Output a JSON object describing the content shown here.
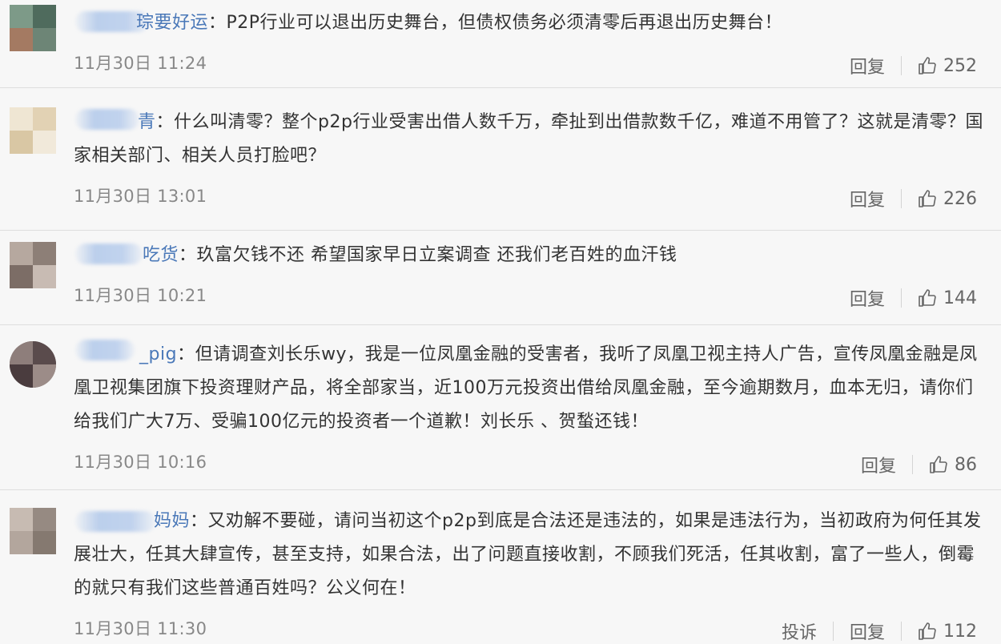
{
  "icons": {
    "like": "thumbs-up-icon"
  },
  "colors": {
    "username": "#4a78b8",
    "text": "#333333",
    "meta": "#888888",
    "background": "#f7f7f7"
  },
  "comments": [
    {
      "username": "琮要好运",
      "text": "P2P行业可以退出历史舞台，但债权债务必须清零后再退出历史舞台！",
      "time": "11月30日 11:24",
      "reply": "回复",
      "likes": "252"
    },
    {
      "username": "青",
      "text": "什么叫清零？整个p2p行业受害出借人数千万，牵扯到出借款数千亿，难道不用管了？这就是清零？国家相关部门、相关人员打脸吧？",
      "time": "11月30日 13:01",
      "reply": "回复",
      "likes": "226"
    },
    {
      "username": "吃货",
      "text": "玖富欠钱不还 希望国家早日立案调查 还我们老百姓的血汗钱",
      "time": "11月30日 10:21",
      "reply": "回复",
      "likes": "144"
    },
    {
      "username": "_pig",
      "text": "但请调查刘长乐wy，我是一位凤凰金融的受害者，我听了凤凰卫视主持人广告，宣传凤凰金融是凤凰卫视集团旗下投资理财产品，将全部家当，近100万元投资出借给凤凰金融，至今逾期数月，血本无归，请你们给我们广大7万、受骗100亿元的投资者一个道歉！刘长乐 、贺蝵还钱！",
      "time": "11月30日 10:16",
      "reply": "回复",
      "likes": "86"
    },
    {
      "username": "妈妈",
      "text": "又劝解不要碰，请问当初这个p2p到底是合法还是违法的，如果是违法行为，当初政府为何任其发展壮大，任其大肆宣传，甚至支持，如果合法，出了问题直接收割，不顾我们死活，任其收割，富了一些人，倒霉的就只有我们这些普通百姓吗？公义何在！",
      "time": "11月30日 11:30",
      "report": "投诉",
      "reply": "回复",
      "likes": "112"
    }
  ]
}
